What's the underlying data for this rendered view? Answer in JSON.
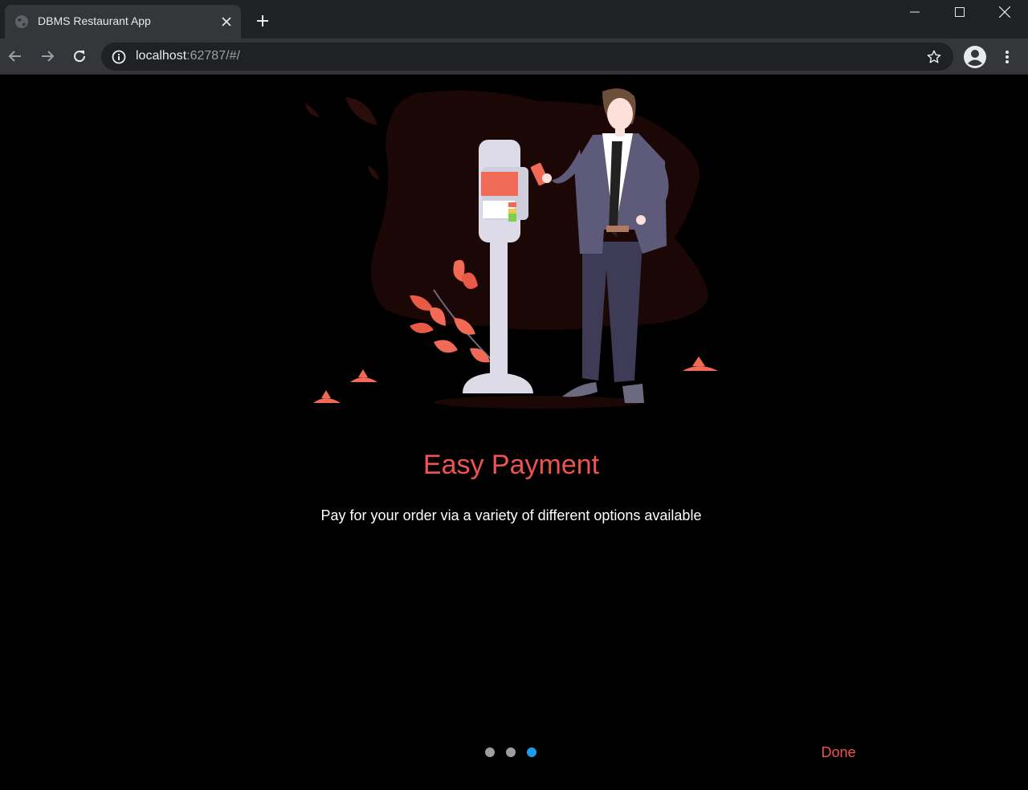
{
  "browser": {
    "tab_title": "DBMS Restaurant App",
    "url_host": "localhost",
    "url_path": ":62787/#/"
  },
  "onboarding": {
    "title": "Easy Payment",
    "description": "Pay for your order via a variety of different options available",
    "page_count": 3,
    "active_page": 3,
    "done_label": "Done"
  },
  "colors": {
    "accent": "#ef5350",
    "active_dot": "#1e9be9",
    "inactive_dot": "#9e9e9e",
    "background": "#000000"
  },
  "icons": {
    "tab": "globe-icon",
    "close": "close-icon",
    "new_tab": "plus-icon",
    "back": "arrow-left-icon",
    "forward": "arrow-right-icon",
    "reload": "reload-icon",
    "info": "info-icon",
    "bookmark": "star-icon",
    "profile": "account-circle-icon",
    "menu": "kebab-menu-icon"
  }
}
